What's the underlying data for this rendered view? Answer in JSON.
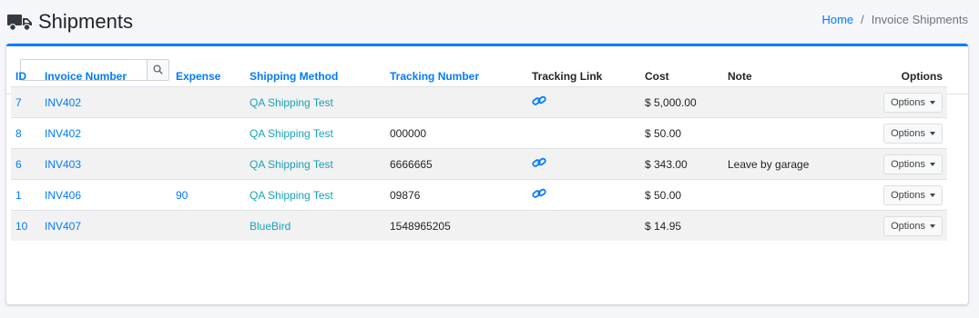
{
  "header": {
    "title": "Shipments",
    "icon": "truck-icon",
    "breadcrumb": {
      "home": "Home",
      "separator": "/",
      "current": "Invoice Shipments"
    }
  },
  "search": {
    "value": "",
    "placeholder": "",
    "icon": "search-icon"
  },
  "colors": {
    "accent": "#007bff",
    "shipping_link": "#17a2b8",
    "row_stripe": "#f2f2f2"
  },
  "table": {
    "columns": {
      "id": "ID",
      "invoice": "Invoice Number",
      "expense": "Expense",
      "method": "Shipping Method",
      "tracking_number": "Tracking Number",
      "tracking_link": "Tracking Link",
      "cost": "Cost",
      "note": "Note",
      "options": "Options"
    },
    "rows": [
      {
        "id": "7",
        "invoice": "INV402",
        "expense": "",
        "method": "QA Shipping Test",
        "tracking_number": "",
        "has_link": true,
        "cost": "$ 5,000.00",
        "note": "",
        "options": "Options"
      },
      {
        "id": "8",
        "invoice": "INV402",
        "expense": "",
        "method": "QA Shipping Test",
        "tracking_number": "000000",
        "has_link": false,
        "cost": "$ 50.00",
        "note": "",
        "options": "Options"
      },
      {
        "id": "6",
        "invoice": "INV403",
        "expense": "",
        "method": "QA Shipping Test",
        "tracking_number": "6666665",
        "has_link": true,
        "cost": "$ 343.00",
        "note": "Leave by garage",
        "options": "Options"
      },
      {
        "id": "1",
        "invoice": "INV406",
        "expense": "90",
        "method": "QA Shipping Test",
        "tracking_number": "09876",
        "has_link": true,
        "cost": "$ 50.00",
        "note": "",
        "options": "Options"
      },
      {
        "id": "10",
        "invoice": "INV407",
        "expense": "",
        "method": "BlueBird",
        "tracking_number": "1548965205",
        "has_link": false,
        "cost": "$ 14.95",
        "note": "",
        "options": "Options"
      }
    ]
  }
}
